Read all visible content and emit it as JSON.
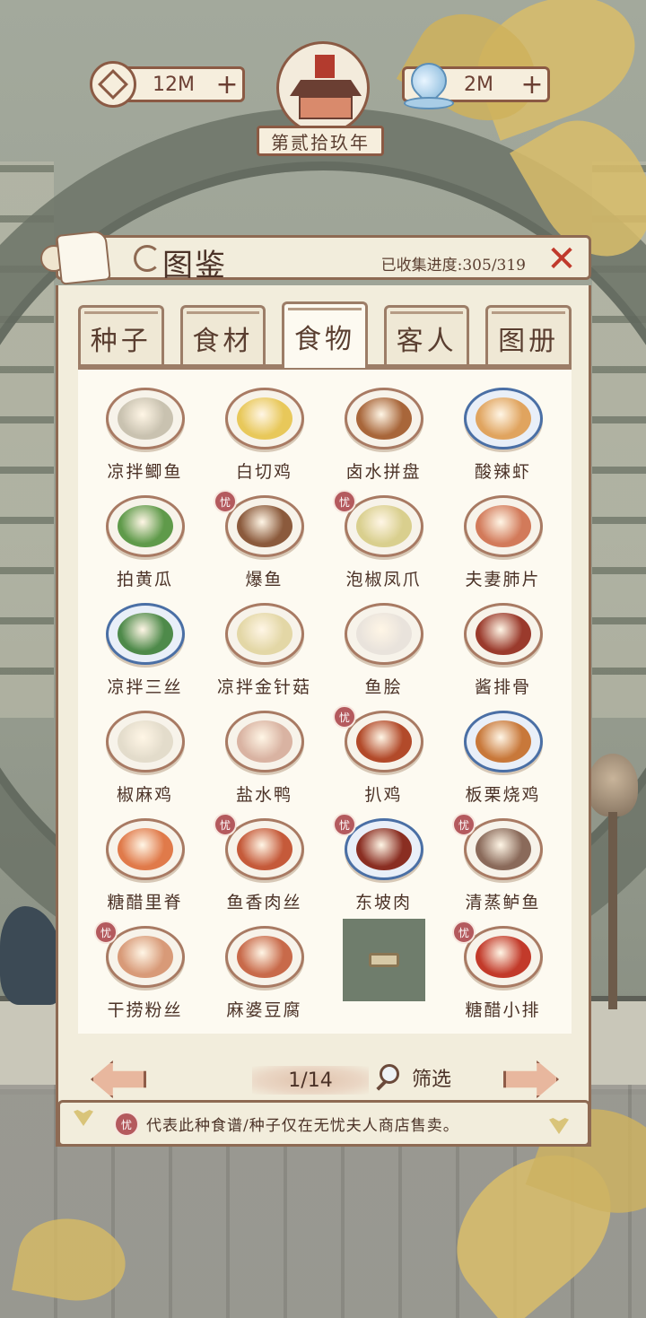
{
  "hud": {
    "coins": "12M",
    "gems": "2M",
    "plus": "+",
    "year": "第贰拾玖年"
  },
  "panel": {
    "title": "图鉴",
    "progress": "已收集进度:305/319",
    "close": "✕"
  },
  "tabs": [
    {
      "label": "种子",
      "active": false
    },
    {
      "label": "食材",
      "active": false
    },
    {
      "label": "食物",
      "active": true
    },
    {
      "label": "客人",
      "active": false
    },
    {
      "label": "图册",
      "active": false
    }
  ],
  "dishes": [
    {
      "name": "凉拌鲫鱼",
      "shop_only": false,
      "bowl": false,
      "color": "#c9c2b0"
    },
    {
      "name": "白切鸡",
      "shop_only": false,
      "bowl": false,
      "color": "#e8c85a"
    },
    {
      "name": "卤水拼盘",
      "shop_only": false,
      "bowl": false,
      "color": "#a8663a"
    },
    {
      "name": "酸辣虾",
      "shop_only": false,
      "bowl": true,
      "color": "#e0a45f"
    },
    {
      "name": "拍黄瓜",
      "shop_only": false,
      "bowl": false,
      "color": "#5f9a4a"
    },
    {
      "name": "爆鱼",
      "shop_only": true,
      "bowl": false,
      "color": "#8b5a3c"
    },
    {
      "name": "泡椒凤爪",
      "shop_only": true,
      "bowl": false,
      "color": "#d9cf8e"
    },
    {
      "name": "夫妻肺片",
      "shop_only": false,
      "bowl": false,
      "color": "#d27a5a"
    },
    {
      "name": "凉拌三丝",
      "shop_only": false,
      "bowl": true,
      "color": "#4e8a4a"
    },
    {
      "name": "凉拌金针菇",
      "shop_only": false,
      "bowl": false,
      "color": "#e3d7a6"
    },
    {
      "name": "鱼脍",
      "shop_only": false,
      "bowl": false,
      "color": "#e9e3dc"
    },
    {
      "name": "酱排骨",
      "shop_only": false,
      "bowl": false,
      "color": "#9a3a2c"
    },
    {
      "name": "椒麻鸡",
      "shop_only": false,
      "bowl": false,
      "color": "#e3dccb"
    },
    {
      "name": "盐水鸭",
      "shop_only": false,
      "bowl": false,
      "color": "#d9b3a2"
    },
    {
      "name": "扒鸡",
      "shop_only": true,
      "bowl": false,
      "color": "#b24a2a"
    },
    {
      "name": "板栗烧鸡",
      "shop_only": false,
      "bowl": true,
      "color": "#c8783a"
    },
    {
      "name": "糖醋里脊",
      "shop_only": false,
      "bowl": false,
      "color": "#e07a4a"
    },
    {
      "name": "鱼香肉丝",
      "shop_only": true,
      "bowl": false,
      "color": "#c55a3a"
    },
    {
      "name": "东坡肉",
      "shop_only": true,
      "bowl": true,
      "color": "#8a2e22"
    },
    {
      "name": "清蒸鲈鱼",
      "shop_only": true,
      "bowl": false,
      "color": "#8a6a5a"
    },
    {
      "name": "干捞粉丝",
      "shop_only": true,
      "bowl": false,
      "color": "#d89a78"
    },
    {
      "name": "麻婆豆腐",
      "shop_only": false,
      "bowl": false,
      "color": "#c86a4a"
    },
    {
      "name": "",
      "shop_only": false,
      "bowl": false,
      "locked": true,
      "color": "#6f7d6c"
    },
    {
      "name": "糖醋小排",
      "shop_only": true,
      "bowl": false,
      "color": "#c23a2a"
    }
  ],
  "pager": {
    "page": "1/14",
    "filter": "筛选"
  },
  "footer": {
    "badge": "忧",
    "note": "代表此种食谱/种子仅在无忧夫人商店售卖。"
  }
}
